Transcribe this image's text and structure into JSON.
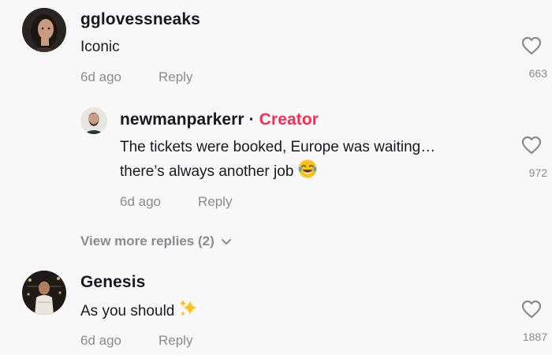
{
  "comments": [
    {
      "username": "gglovessneaks",
      "text": "Iconic",
      "time": "6d ago",
      "reply_label": "Reply",
      "likes": "663",
      "avatar_icon": "profile-photo"
    },
    {
      "username": "newmanparkerr",
      "separator": "·",
      "creator_label": "Creator",
      "text_line1": "The tickets were booked, Europe was waiting…",
      "text_line2": "there’s always another job",
      "emoji": "face-with-tears-of-joy-icon",
      "time": "6d ago",
      "reply_label": "Reply",
      "likes": "972",
      "avatar_icon": "profile-photo"
    },
    {
      "username": "Genesis",
      "text": "As you should",
      "emoji": "sparkles-icon",
      "time": "6d ago",
      "reply_label": "Reply",
      "likes": "1887",
      "avatar_icon": "profile-photo"
    }
  ],
  "view_more_replies": "View more replies (2)",
  "colors": {
    "background": "#f8f8f8",
    "text": "#161823",
    "secondary": "#8a8b91",
    "creator": "#fe2c55"
  }
}
